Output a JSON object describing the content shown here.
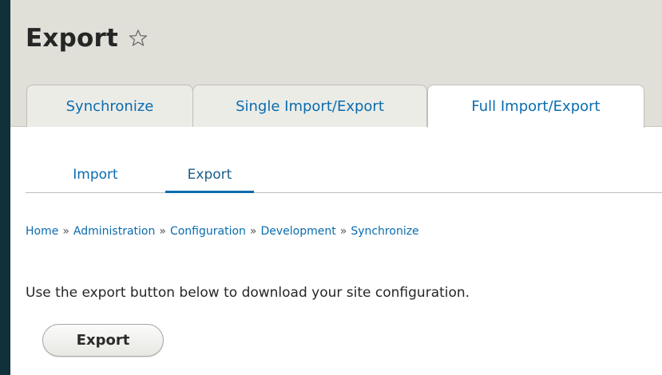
{
  "page": {
    "title": "Export",
    "favorite_icon": "star-outline-icon"
  },
  "primary_tabs": [
    {
      "label": "Synchronize",
      "active": false
    },
    {
      "label": "Single Import/Export",
      "active": false
    },
    {
      "label": "Full Import/Export",
      "active": true
    }
  ],
  "secondary_tabs": [
    {
      "label": "Import",
      "active": false
    },
    {
      "label": "Export",
      "active": true
    }
  ],
  "breadcrumb": {
    "items": [
      "Home",
      "Administration",
      "Configuration",
      "Development",
      "Synchronize"
    ],
    "separator": "»"
  },
  "content": {
    "description": "Use the export button below to download your site configuration.",
    "export_button_label": "Export"
  },
  "colors": {
    "link": "#0a6cae",
    "header_bg": "#e0e0d8",
    "frame_bg": "#10303a",
    "text": "#262626"
  }
}
